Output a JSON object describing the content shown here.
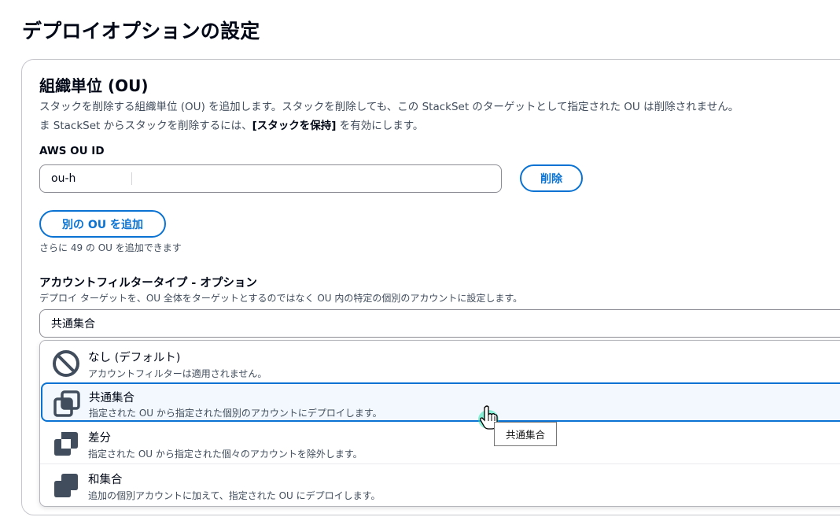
{
  "page_title": "デプロイオプションの設定",
  "ou_section": {
    "title": "組織単位 (OU)",
    "desc_line1": "スタックを削除する組織単位 (OU) を追加します。スタックを削除しても、この StackSet のターゲットとして指定された OU は削除されません。",
    "desc_line2_pre": "ま StackSet からスタックを削除するには、",
    "desc_line2_bold": "[スタックを保持]",
    "desc_line2_post": " を有効にします。",
    "field_label": "AWS OU ID",
    "input_value": "ou-h",
    "remove_button": "削除",
    "add_button": "別の OU を追加",
    "hint": "さらに 49 の OU を追加できます"
  },
  "filter": {
    "label": "アカウントフィルタータイプ - オプション",
    "desc": "デプロイ ターゲットを、OU 全体をターゲットとするのではなく OU 内の特定の個別のアカウントに設定します。",
    "selected": "共通集合",
    "options": [
      {
        "title": "なし (デフォルト)",
        "desc": "アカウントフィルターは適用されません。",
        "icon": "no-entry-icon"
      },
      {
        "title": "共通集合",
        "desc": "指定された OU から指定された個別のアカウントにデプロイします。",
        "icon": "intersection-icon"
      },
      {
        "title": "差分",
        "desc": "指定された OU から指定された個々のアカウントを除外します。",
        "icon": "difference-icon"
      },
      {
        "title": "和集合",
        "desc": "追加の個別アカウントに加えて、指定された OU にデプロイします。",
        "icon": "union-icon"
      }
    ]
  },
  "tooltip": "共通集合",
  "colors": {
    "accent": "#0972d3",
    "highlight_bg": "#f2f8fd",
    "icon_dark": "#414d5c"
  }
}
